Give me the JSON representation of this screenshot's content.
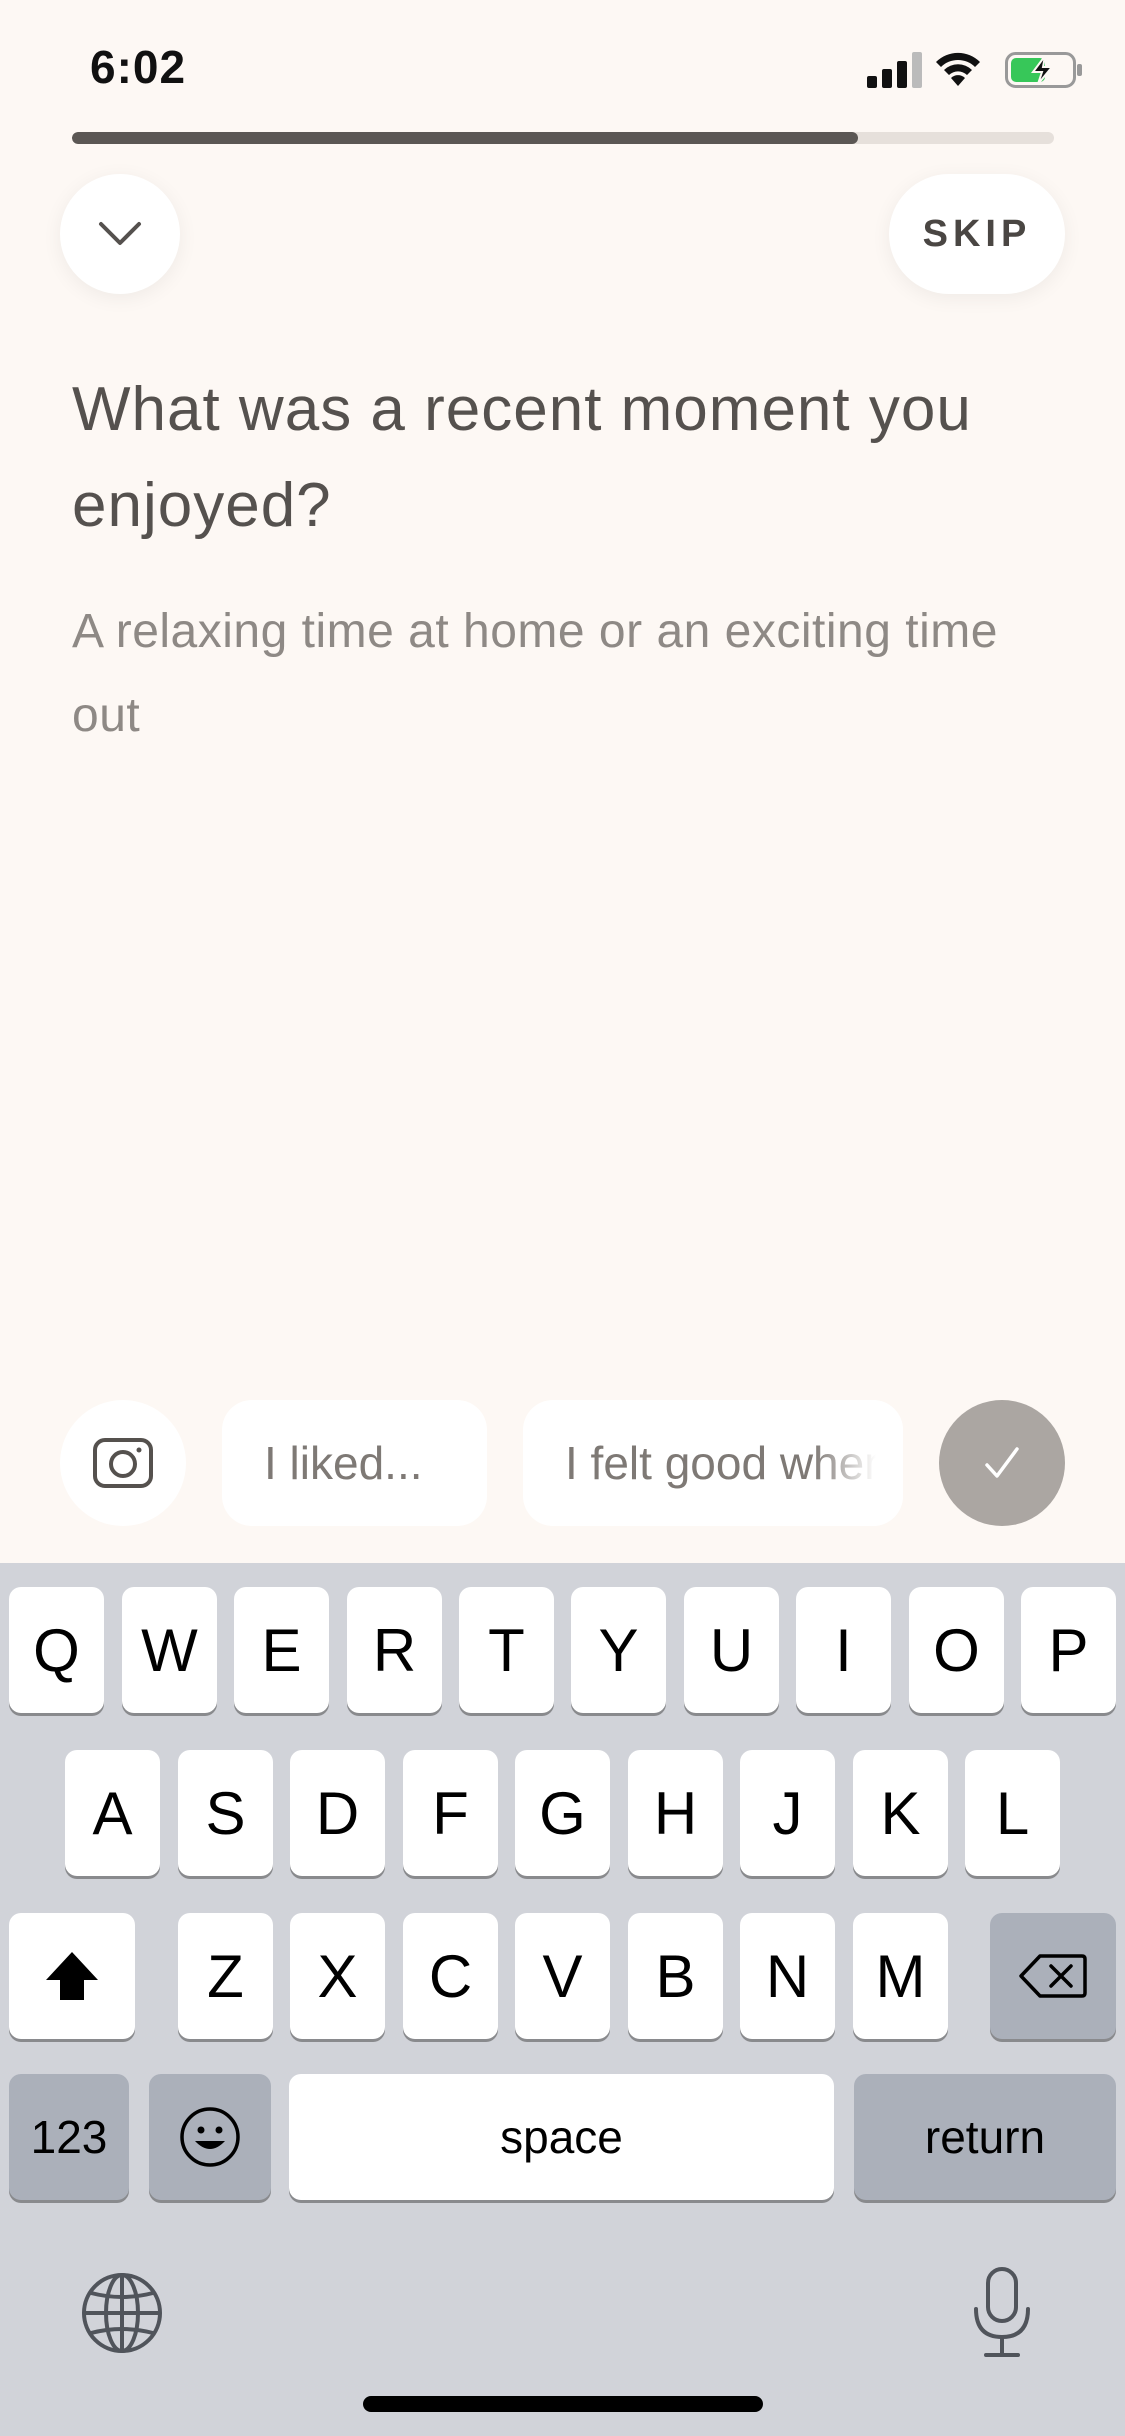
{
  "status_bar": {
    "time": "6:02",
    "icons": [
      "signal-icon",
      "wifi-icon",
      "battery-charging-icon"
    ]
  },
  "progress": {
    "fraction": 0.8
  },
  "header": {
    "collapse_icon": "chevron-down-icon",
    "skip_label": "SKIP"
  },
  "prompt": {
    "question": "What was a recent moment you enjoyed?",
    "hint": "A relaxing time at home or an exciting time out"
  },
  "suggestions": {
    "camera_icon": "camera-icon",
    "chips": [
      "I liked...",
      "I felt good when"
    ],
    "done_icon": "checkmark-icon"
  },
  "keyboard": {
    "row1": [
      "Q",
      "W",
      "E",
      "R",
      "T",
      "Y",
      "U",
      "I",
      "O",
      "P"
    ],
    "row2": [
      "A",
      "S",
      "D",
      "F",
      "G",
      "H",
      "J",
      "K",
      "L"
    ],
    "row3": [
      "Z",
      "X",
      "C",
      "V",
      "B",
      "N",
      "M"
    ],
    "numbers_label": "123",
    "space_label": "space",
    "return_label": "return",
    "icons": [
      "shift-icon",
      "backspace-icon",
      "emoji-icon",
      "globe-icon",
      "microphone-icon"
    ]
  },
  "colors": {
    "background": "#fdf8f4",
    "progress_fill": "#5b5754",
    "done_button": "#aba6a2",
    "keyboard_bg": "#d1d3d9"
  }
}
